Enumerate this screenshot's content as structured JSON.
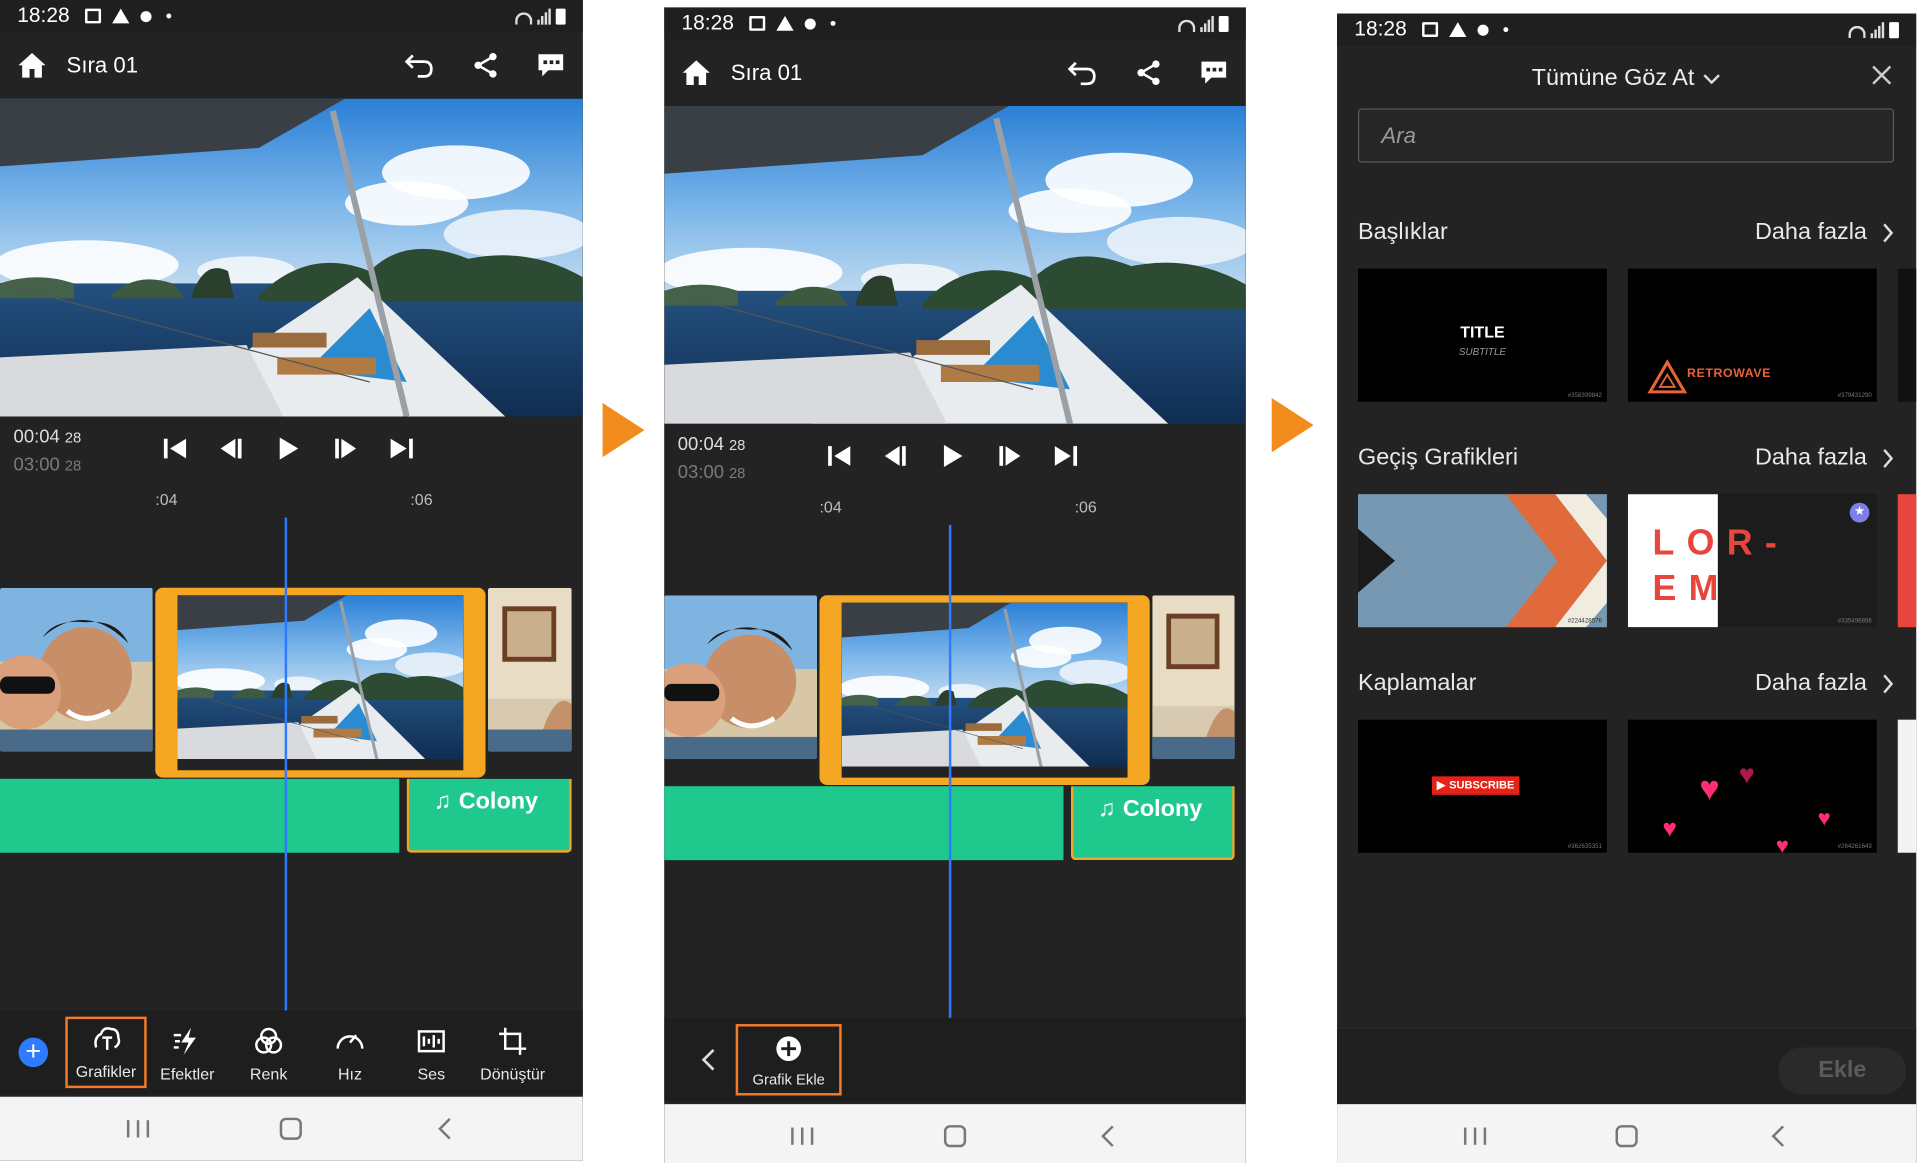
{
  "status_bar": {
    "time": "18:28"
  },
  "editor": {
    "title": "Sıra 01",
    "current_time": "00:04",
    "current_frames": "28",
    "duration": "03:00",
    "duration_frames": "28",
    "ruler_marks": [
      ":04",
      ":06"
    ],
    "audio_track": "Colony",
    "tools": [
      {
        "label": "Grafikler",
        "icon": "graphics-icon"
      },
      {
        "label": "Efektler",
        "icon": "effects-icon"
      },
      {
        "label": "Renk",
        "icon": "color-icon"
      },
      {
        "label": "Hız",
        "icon": "speed-icon"
      },
      {
        "label": "Ses",
        "icon": "audio-icon"
      },
      {
        "label": "Dönüştür",
        "icon": "transform-icon"
      }
    ],
    "add_graphic_label": "Grafik Ekle"
  },
  "browser": {
    "title": "Tümüne Göz At",
    "search_placeholder": "Ara",
    "more_label": "Daha fazla",
    "sections": [
      {
        "title": "Başlıklar",
        "thumbs": [
          {
            "text": "TITLE",
            "sub": "SUBTITLE",
            "id": "#358399842"
          },
          {
            "text": "RETROWAVE",
            "id": "#379431290"
          }
        ]
      },
      {
        "title": "Geçiş Grafikleri",
        "thumbs": [
          {
            "id": "#224428576"
          },
          {
            "text": "LOR-EM",
            "id": "#335496896"
          }
        ]
      },
      {
        "title": "Kaplamalar",
        "thumbs": [
          {
            "text": "SUBSCRIBE",
            "id": "#362635351"
          },
          {
            "id": "#264261643"
          }
        ]
      }
    ],
    "add_button": "Ekle"
  },
  "colors": {
    "accent_orange": "#f5a623",
    "playhead_blue": "#2f7bff",
    "audio_green": "#1fc98e",
    "arrow_orange": "#f28c1d"
  }
}
